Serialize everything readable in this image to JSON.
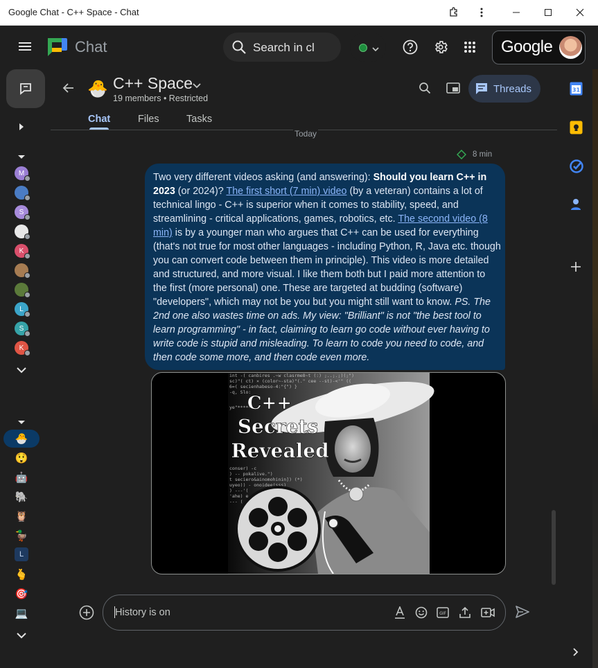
{
  "window": {
    "title": "Google Chat - C++ Space - Chat"
  },
  "app": {
    "logo_text": "Chat",
    "search_placeholder": "Search in cl",
    "google_wordmark": "Google"
  },
  "space": {
    "emoji": "🐣",
    "name": "C++ Space",
    "subtitle": "19 members • Restricted",
    "threads_label": "Threads"
  },
  "tabs": [
    {
      "label": "Chat"
    },
    {
      "label": "Files"
    },
    {
      "label": "Tasks"
    }
  ],
  "conversation": {
    "day_label": "Today",
    "message_time": "8 min",
    "message": {
      "intro": "Two very different videos asking (and answering): ",
      "bold_question": "Should you learn C++ in 2023",
      "after_bold": " (or 2024)? ",
      "link1": "The first short (7 min) video",
      "part2": " (by a veteran) contains a lot of technical lingo - C++ is superior when it comes to stability, speed, and streamlining - critical applications, games, robotics, etc. ",
      "link2": "The second video (8 min)",
      "part3": " is by a younger man who argues that C++ can be used for everything (that's not true for most other languages - including Python, R, Java etc. though you can convert code between them in principle). This video is more detailed and structured, and more visual. I like them both but I paid more attention to the first (more personal) one. These are targeted at budding (software) \"developers\", which may not be you but you might still want to know. ",
      "italic": "PS. The 2nd one also wastes time on ads. My view: \"Brilliant\" is not \"the best tool to learn programming\" - in fact, claiming to learn go code without ever having to write code is stupid and misleading. To learn to code you need to code, and then code some more, and then code even more."
    },
    "video_title": "C++ Secrets Revealed",
    "video_title_lines": [
      "C++",
      "Secrets",
      "Revealed"
    ]
  },
  "composer": {
    "placeholder": "History is on"
  },
  "rail": {
    "dm_avatars": [
      {
        "letter": "M",
        "color": "#9b7fd4"
      },
      {
        "letter": "",
        "color": "#4a7cc4"
      },
      {
        "letter": "S",
        "color": "#a78bdb"
      },
      {
        "letter": "",
        "color": "#e8e8e8"
      },
      {
        "letter": "K",
        "color": "#d94f6b"
      },
      {
        "letter": "",
        "color": "#a67c52"
      },
      {
        "letter": "",
        "color": "#5b7a3a"
      },
      {
        "letter": "L",
        "color": "#3ba5c9"
      },
      {
        "letter": "S",
        "color": "#36a3a8"
      },
      {
        "letter": "K",
        "color": "#e05545"
      }
    ],
    "space_icons": [
      {
        "glyph": "🐣"
      },
      {
        "glyph": "😲"
      },
      {
        "glyph": "🤖"
      },
      {
        "glyph": "🐘"
      },
      {
        "glyph": "🦉"
      },
      {
        "glyph": "🦆"
      },
      {
        "glyph": "L"
      },
      {
        "glyph": "🫰"
      },
      {
        "glyph": "🎯"
      },
      {
        "glyph": "💻"
      }
    ],
    "right_apps": [
      {
        "icon": "calendar-icon",
        "label": "31"
      },
      {
        "icon": "keep-icon"
      },
      {
        "icon": "tasks-icon"
      },
      {
        "icon": "contacts-icon"
      },
      {
        "icon": "add-icon"
      }
    ]
  },
  "colors": {
    "accent": "#a8c7fa",
    "bubble": "#0b3458",
    "link": "#8ab4f8",
    "online": "#1e8e3e"
  }
}
